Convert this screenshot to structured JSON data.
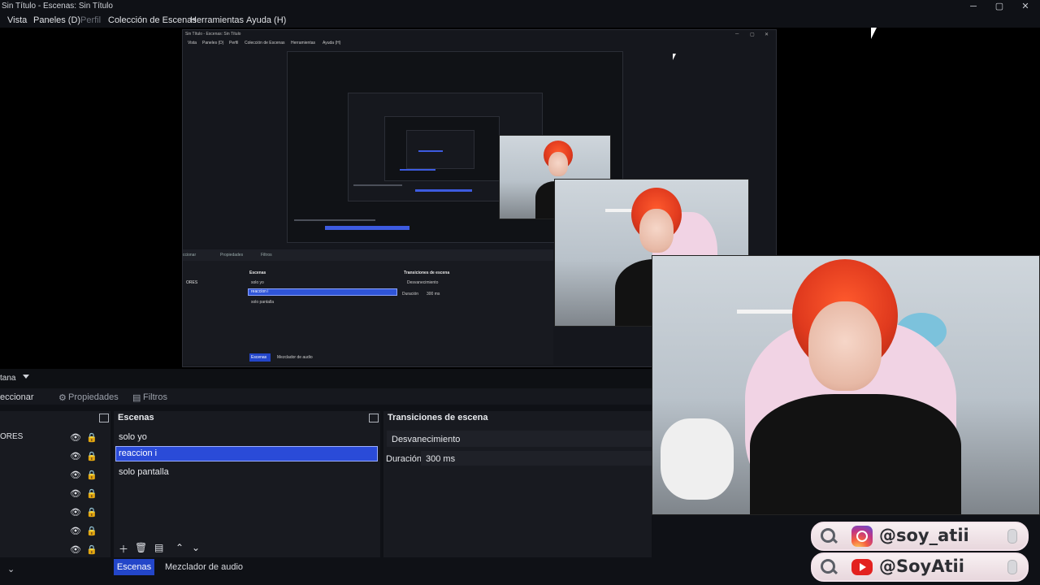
{
  "window": {
    "title": "Sin Título - Escenas: Sin Título"
  },
  "menu": [
    "Vista",
    "Paneles (D)",
    "Perfil",
    "Colección de Escenas",
    "Herramientas",
    "Ayuda (H)"
  ],
  "dock": {
    "left_label": "tana",
    "toolbar": {
      "left": "eccionar",
      "properties": "Propiedades",
      "filters": "Filtros"
    },
    "sources_label": "ORES",
    "scenes_header": "Escenas",
    "scenes": [
      "solo yo",
      "reaccion i",
      "solo pantalla"
    ],
    "selected_scene": "reaccion i",
    "transitions_header": "Transiciones de escena",
    "transition": "Desvanecimiento",
    "duration_label": "Duración",
    "duration_value": "300 ms",
    "tabs": {
      "scenes": "Escenas",
      "mixer": "Mezclador de audio"
    }
  },
  "nested": {
    "title": "Sin Título - Escenas: Sin Título",
    "menu": [
      "Vista",
      "Paneles (D)",
      "Perfil",
      "Colección de Escenas",
      "Herramientas",
      "Ayuda (H)"
    ],
    "toolbar": {
      "left": "ccionar",
      "properties": "Propiedades",
      "filters": "Filtros"
    },
    "scenes_header": "Escenas",
    "scenes": [
      "solo yo",
      "reaccion i",
      "solo pantalla"
    ],
    "transitions_header": "Transiciones de escena",
    "transition": "Desvanecimiento",
    "duration_label": "Duración",
    "duration_value": "300 ms",
    "tabs": {
      "scenes": "Escenas",
      "mixer": "Mezclador de audio"
    },
    "sources_label": "ORES"
  },
  "social": [
    {
      "platform": "instagram",
      "handle": "@soy_atii",
      "color": "#d93a7c"
    },
    {
      "platform": "youtube",
      "handle": "@SoyAtii",
      "color": "#e3211f"
    }
  ],
  "icons": {
    "eye": "eye-icon",
    "lock": "lock-icon",
    "add": "plus-icon",
    "delete": "trash-icon",
    "filter": "filter-icon",
    "up": "arrow-up-icon",
    "down": "arrow-down-icon"
  }
}
